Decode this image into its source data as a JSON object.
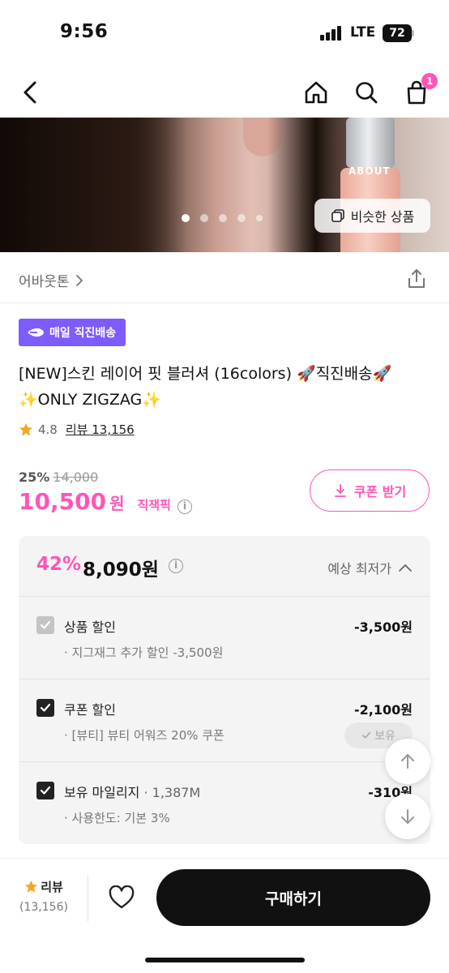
{
  "status_bar": {
    "time": "9:56",
    "network": "LTE",
    "battery": "72"
  },
  "nav": {
    "cart_count": "1"
  },
  "image": {
    "similar_label": "비슷한 상품",
    "label": "ABOUT"
  },
  "brand": {
    "name": "어바웃톤"
  },
  "badge": {
    "label": "매일 직진배송"
  },
  "product": {
    "title_line1": "[NEW]스킨 레이어 핏 블러셔 (16colors) 🚀직진배송🚀",
    "title_line2": "✨ONLY ZIGZAG✨",
    "rating": "4.8",
    "review_label": "리뷰 13,156"
  },
  "pricing": {
    "discount_rate": "25%",
    "original_price": "14,000",
    "price": "10,500",
    "unit": "원",
    "direct_tag": "직잭픽",
    "coupon_label": "쿠폰 받기"
  },
  "lowest": {
    "rate": "42%",
    "price": "8,090원",
    "label": "예상 최저가",
    "items": [
      {
        "name": "상품 할인",
        "sub": "",
        "amount": "-3,500원",
        "detail": "· 지그재그 추가 할인 -3,500원"
      },
      {
        "name": "쿠폰 할인",
        "sub": "",
        "amount": "-2,100원",
        "detail": "· [뷰티] 뷰티 어워즈 20% 쿠폰",
        "owned": "보유"
      },
      {
        "name": "보유 마일리지",
        "sub": " · 1,387M",
        "amount": "-310원",
        "detail": "· 사용한도: 기본 3%"
      }
    ]
  },
  "bottom": {
    "review_label": "리뷰",
    "review_count": "(13,156)",
    "buy_label": "구매하기"
  },
  "colors": {
    "accent": "#ff55b8",
    "badge": "#7d5cff",
    "dark": "#111111"
  }
}
